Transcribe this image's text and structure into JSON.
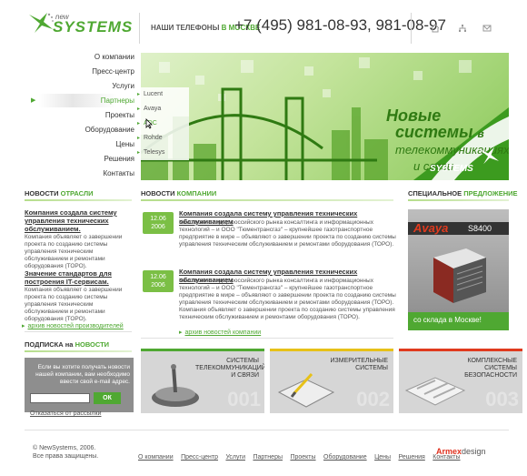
{
  "logo": {
    "new": "new",
    "name": "SYSTEMS"
  },
  "header": {
    "phones_label": "НАШИ ТЕЛЕФОНЫ",
    "phones_city": "В МОСКВЕ",
    "phones": "+7 (495)   981-08-93,    981-08-97",
    "icons": [
      "home-icon",
      "sitemap-icon",
      "mail-icon"
    ]
  },
  "menu": {
    "items": [
      {
        "label": "О компании"
      },
      {
        "label": "Пресс-центр"
      },
      {
        "label": "Услуги"
      },
      {
        "label": "Партнеры",
        "active": true
      },
      {
        "label": "Проекты"
      },
      {
        "label": "Оборудование"
      },
      {
        "label": "Цены"
      },
      {
        "label": "Решения"
      },
      {
        "label": "Контакты"
      }
    ]
  },
  "submenu": {
    "items": [
      {
        "label": "Lucent"
      },
      {
        "label": "Avaya"
      },
      {
        "label": "ADC",
        "hover": true
      },
      {
        "label": "Rohde"
      },
      {
        "label": "Telesys"
      }
    ]
  },
  "banner": {
    "line1": "Новые",
    "line2a": "системы",
    "line2b": "в",
    "line3": "телекоммуникациях",
    "line4": "и связи",
    "logo": "SYSTEMS"
  },
  "industry_news": {
    "heading_a": "НОВОСТИ",
    "heading_b": "ОТРАСЛИ",
    "items": [
      {
        "title": "Компания создала систему управления технических обслуживанием.",
        "text": "Компания объявляет о завершении проекта по созданию системы управления техническим обслуживанием и ремонтами оборудования (ТОРО)."
      },
      {
        "title": "Значение стандартов для построения IT-сервисам.",
        "text": "Компания объявляет о завершении проекта по созданию системы управления техническим обслуживанием и ремонтами оборудования (ТОРО)."
      }
    ],
    "archive": "архив новостей производителей"
  },
  "company_news": {
    "heading_a": "НОВОСТИ",
    "heading_b": "КОМПАНИИ",
    "items": [
      {
        "date_day": "12.06",
        "date_year": "2006",
        "title": "Компания создала систему управления технических обслуживанием",
        "text": "Компания – лидер российского рынка консалтинга и информационных технологий – и ООО \"Тюментрансгаз\" – крупнейшее газотранспортное предприятие в мире – объявляют о завершении проекта по созданию системы управления техническим обслуживанием и ремонтами оборудования (ТОРО)."
      },
      {
        "date_day": "12.06",
        "date_year": "2006",
        "title": "Компания создала систему управления технических обслуживанием",
        "text": "Компания – лидер российского рынка консалтинга и информационных технологий – и ООО \"Тюментрансгаз\" – крупнейшее газотранспортное предприятие в мире – объявляют о завершении проекта по созданию системы управления техническим обслуживанием и ремонтами оборудования (ТОРО). Компания объявляет о завершении проекта по созданию системы управления техническим обслуживанием и ремонтами оборудования (ТОРО)."
      }
    ],
    "archive": "архив новостей компании"
  },
  "special": {
    "heading_a": "СПЕЦИАЛЬНОЕ",
    "heading_b": "ПРЕДЛОЖЕНИЕ",
    "brand": "Avaya",
    "model": "S8400",
    "caption": "со склада в Москве!"
  },
  "subscribe": {
    "heading_a": "ПОДПИСКА",
    "heading_mid": "на",
    "heading_b": "НОВОСТИ",
    "text": "Если вы хотите получать новости нашей компании, вам необходимо ввести свой e-mail адрес.",
    "button": "ОК",
    "unsubscribe": "Отказаться от рассылки"
  },
  "products": [
    {
      "label": "СИСТЕМЫ ТЕЛЕКОММУНИКАЦИЙ И СВЯЗИ",
      "num": "001",
      "color": "#4fa832"
    },
    {
      "label": "ИЗМЕРИТЕЛЬНЫЕ СИСТЕМЫ",
      "num": "002",
      "color": "#e7c118"
    },
    {
      "label": "КОМПЛЕКСНЫЕ СИСТЕМЫ БЕЗОПАСНОСТИ",
      "num": "003",
      "color": "#e03a1e"
    }
  ],
  "footer": {
    "copy1": "© NewSystems, 2006.",
    "copy2": "Все права защищены.",
    "links": [
      "О компании",
      "Пресс-центр",
      "Услуги",
      "Партнеры",
      "Проекты",
      "Оборудование",
      "Цены",
      "Решения",
      "Контакты"
    ],
    "armex_a": "Armex",
    "armex_b": "design"
  },
  "colors": {
    "accent": "#4fa832",
    "yellow": "#e7c118",
    "red": "#e03a1e"
  }
}
